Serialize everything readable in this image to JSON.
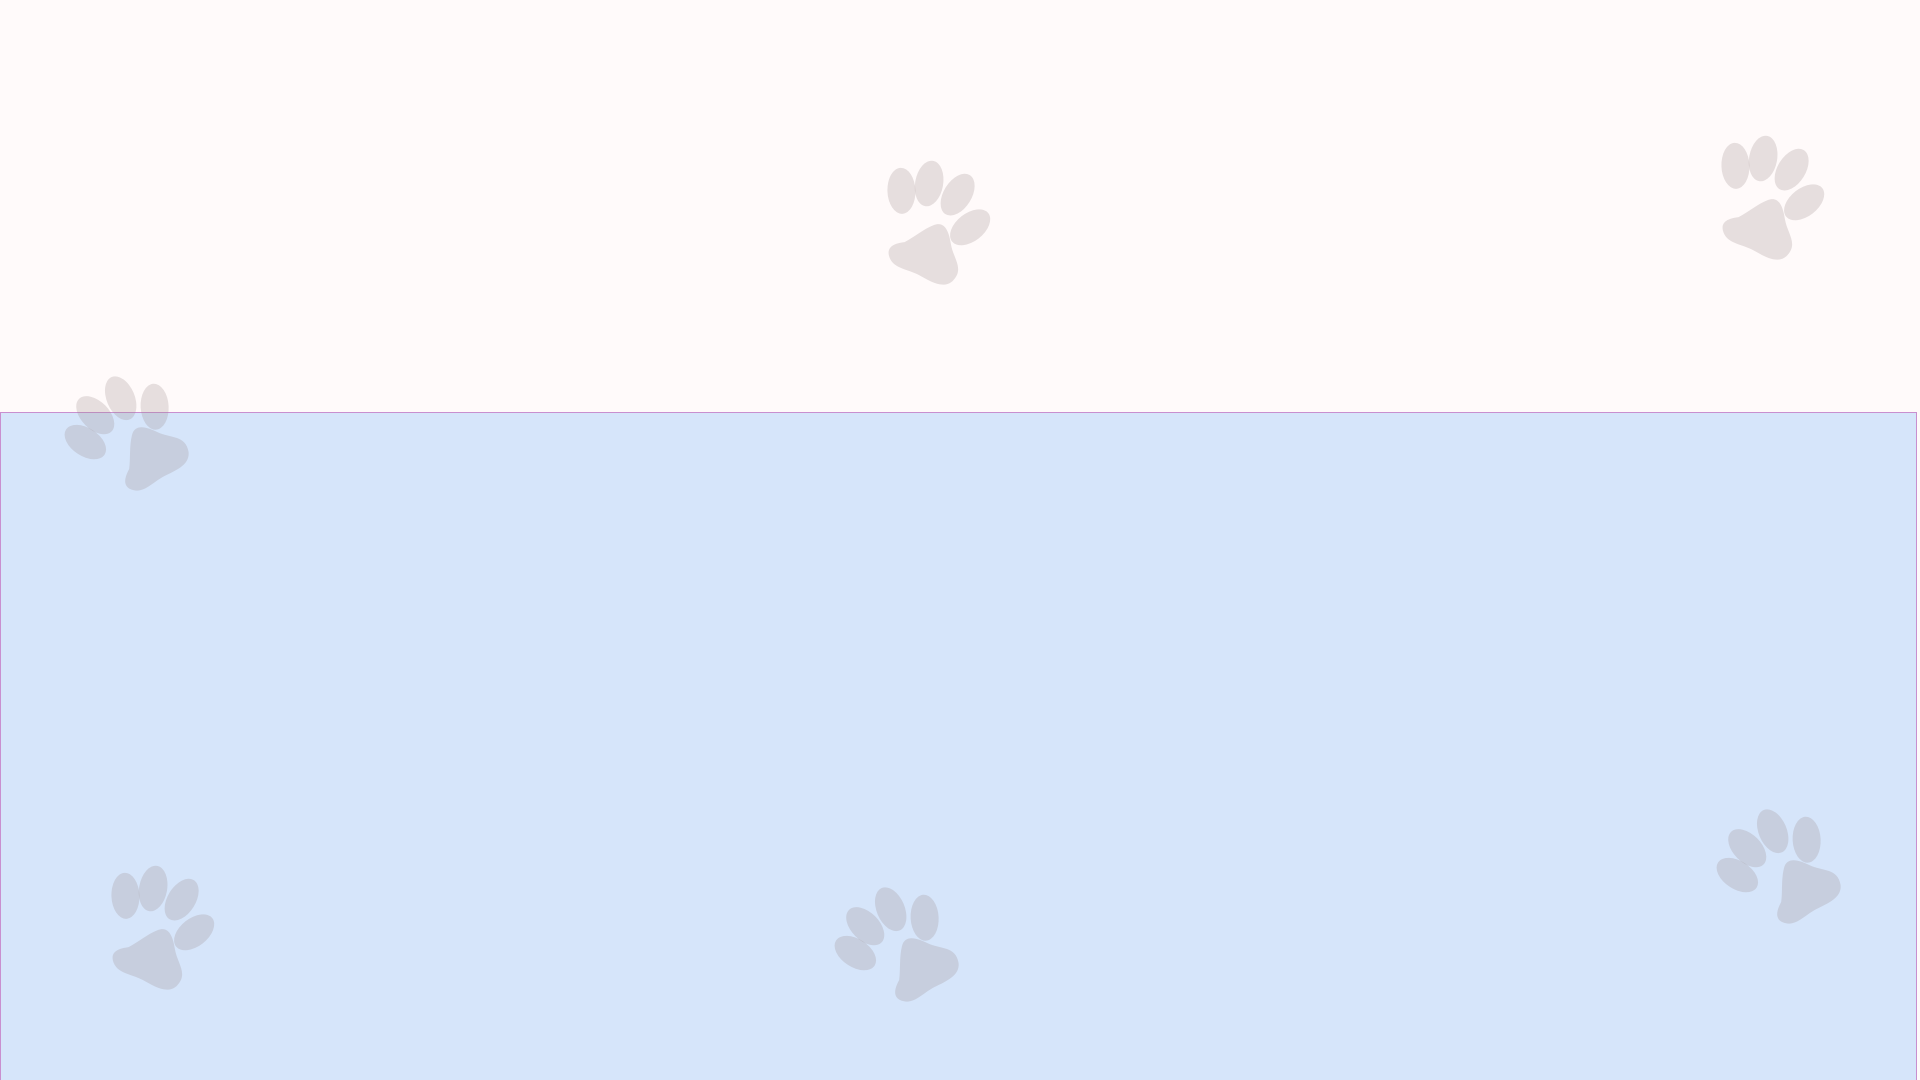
{
  "colors": {
    "top_background": "#fffafa",
    "panel_background": "#d6e5fa",
    "panel_border": "#c98fcf",
    "paw": "#9a8c8c"
  },
  "icons": {
    "decoration": "paw-print-icon"
  }
}
